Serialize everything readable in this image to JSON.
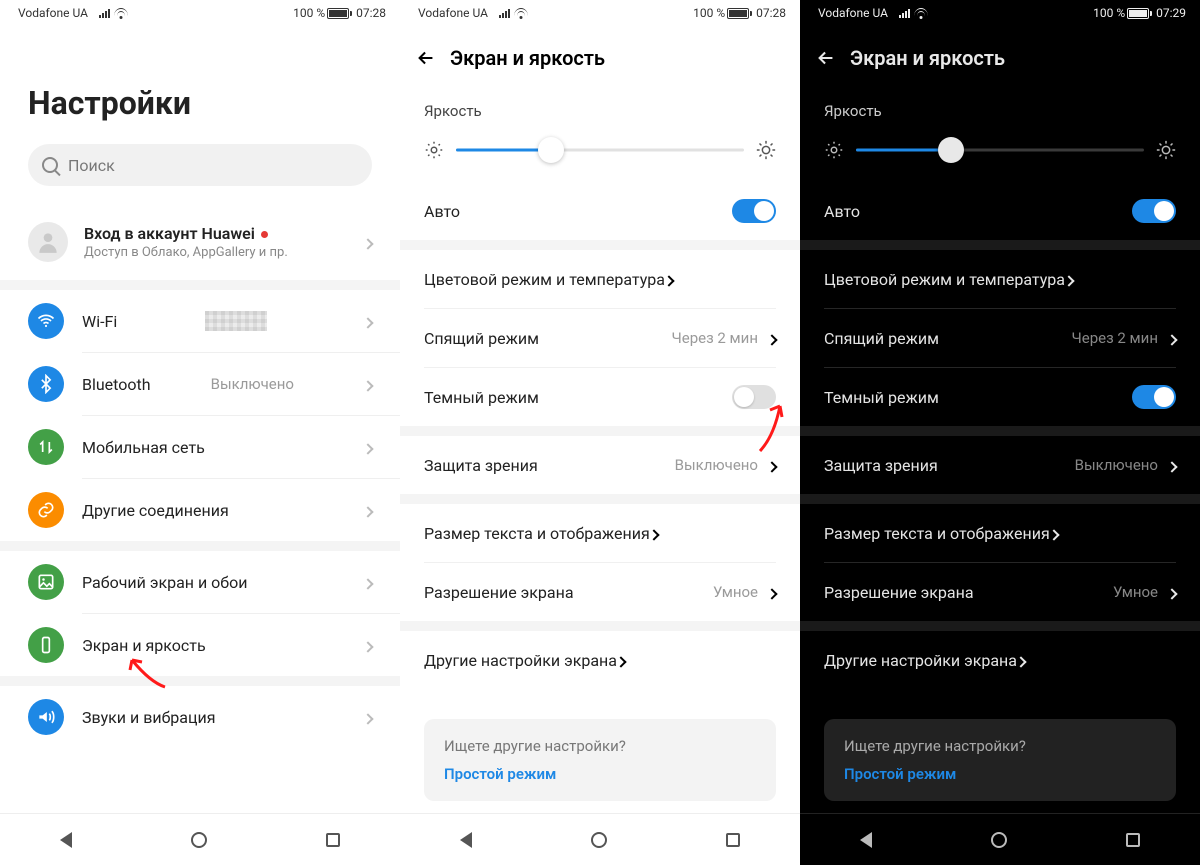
{
  "status": {
    "carrier": "Vodafone UA",
    "battery_pct": "100 %",
    "time_a": "07:28",
    "time_b": "07:28",
    "time_c": "07:29"
  },
  "screen1": {
    "title": "Настройки",
    "search_placeholder": "Поиск",
    "account": {
      "title": "Вход в аккаунт Huawei",
      "subtitle": "Доступ в Облако, AppGallery и пр."
    },
    "items": {
      "wifi": {
        "label": "Wi-Fi"
      },
      "bluetooth": {
        "label": "Bluetooth",
        "value": "Выключено"
      },
      "mobile": {
        "label": "Мобильная сеть"
      },
      "other": {
        "label": "Другие соединения"
      },
      "wallpaper": {
        "label": "Рабочий экран и обои"
      },
      "display": {
        "label": "Экран и яркость"
      },
      "sound": {
        "label": "Звуки и вибрация"
      }
    }
  },
  "display": {
    "header": "Экран и яркость",
    "brightness_label": "Яркость",
    "auto_label": "Авто",
    "color_mode": "Цветовой режим и температура",
    "sleep": {
      "label": "Спящий режим",
      "value": "Через 2 мин"
    },
    "dark_mode": "Темный режим",
    "eye_comfort": {
      "label": "Защита зрения",
      "value": "Выключено"
    },
    "text_size": "Размер текста и отображения",
    "resolution": {
      "label": "Разрешение экрана",
      "value": "Умное"
    },
    "more": "Другие настройки экрана",
    "hint_q": "Ищете другие настройки?",
    "hint_link": "Простой режим"
  }
}
